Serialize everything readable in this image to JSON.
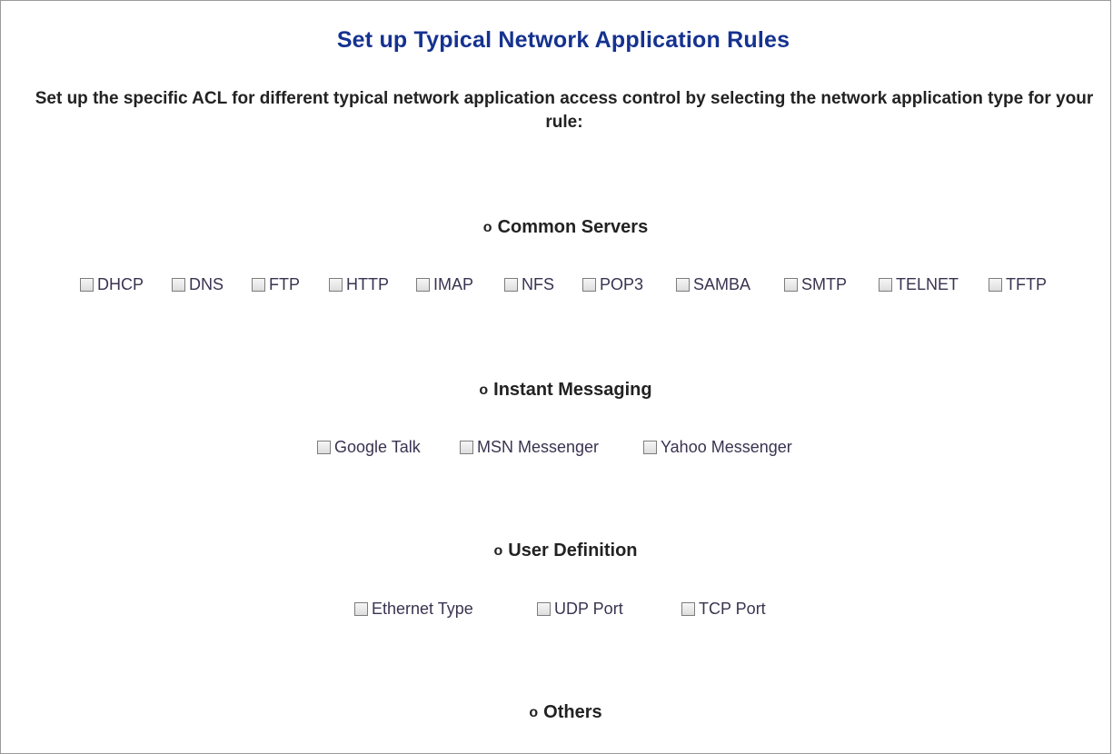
{
  "title": "Set up Typical Network Application Rules",
  "intro": "Set up the specific ACL for different typical network application access control by selecting the network application type for your rule:",
  "bullet": "o",
  "sections": [
    {
      "heading": "Common Servers",
      "options": [
        {
          "label": "DHCP",
          "checked": false
        },
        {
          "label": "DNS",
          "checked": false
        },
        {
          "label": "FTP",
          "checked": false
        },
        {
          "label": "HTTP",
          "checked": false
        },
        {
          "label": "IMAP",
          "checked": false
        },
        {
          "label": "NFS",
          "checked": false
        },
        {
          "label": "POP3",
          "checked": false
        },
        {
          "label": "SAMBA",
          "checked": false
        },
        {
          "label": "SMTP",
          "checked": false
        },
        {
          "label": "TELNET",
          "checked": false
        },
        {
          "label": "TFTP",
          "checked": false
        }
      ]
    },
    {
      "heading": "Instant Messaging",
      "options": [
        {
          "label": "Google Talk",
          "checked": false
        },
        {
          "label": "MSN Messenger",
          "checked": false
        },
        {
          "label": "Yahoo Messenger",
          "checked": false
        }
      ]
    },
    {
      "heading": "User Definition",
      "options": [
        {
          "label": "Ethernet Type",
          "checked": false
        },
        {
          "label": "UDP Port",
          "checked": false
        },
        {
          "label": "TCP Port",
          "checked": false
        }
      ]
    },
    {
      "heading": "Others",
      "options": []
    }
  ]
}
